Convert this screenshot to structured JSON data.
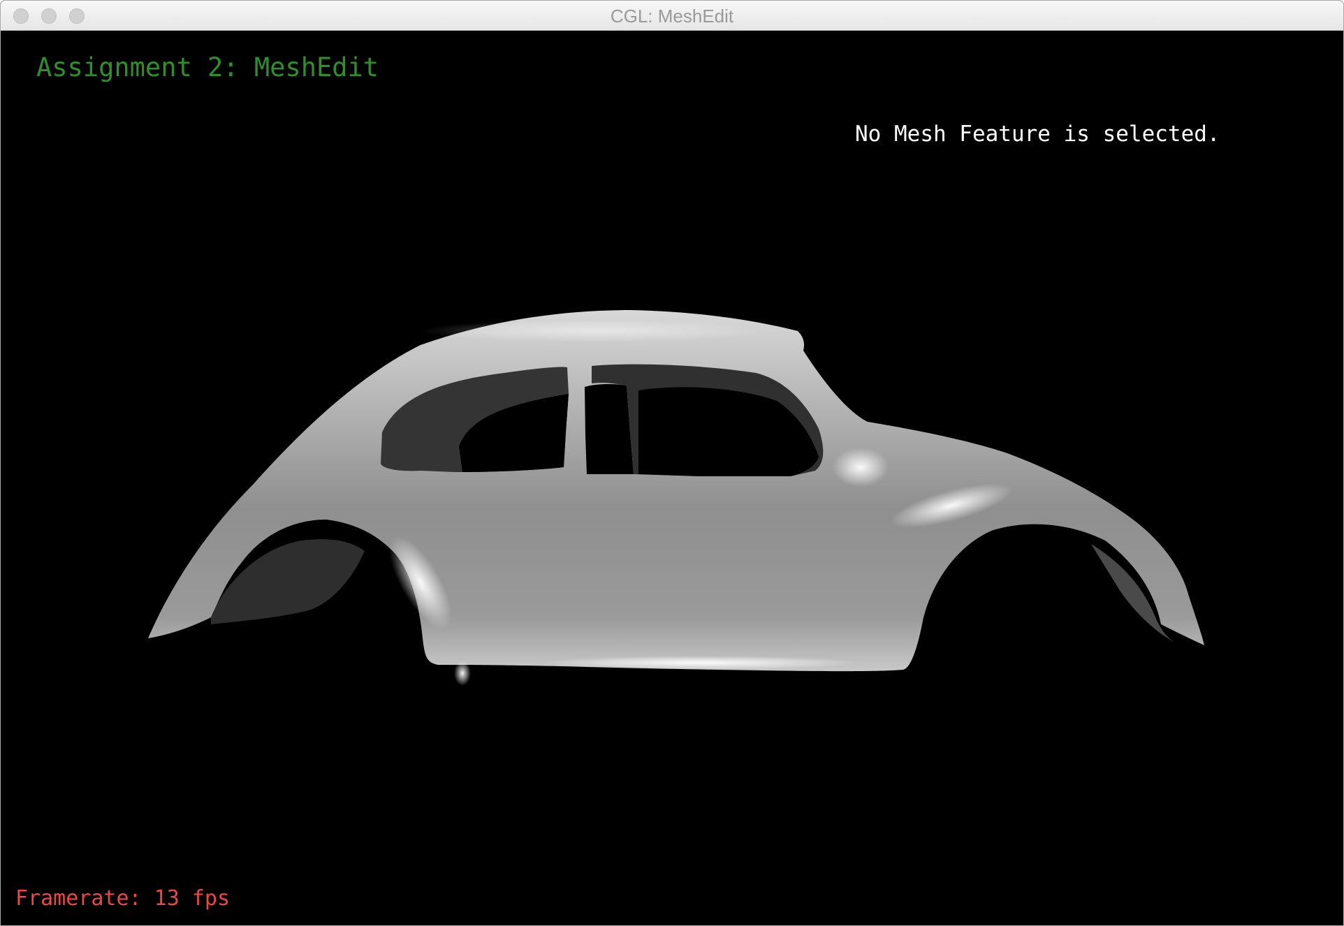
{
  "window": {
    "title": "CGL: MeshEdit",
    "controls": [
      "close",
      "minimize",
      "zoom"
    ]
  },
  "viewport": {
    "background": "#000000",
    "assignment_title": "Assignment 2: MeshEdit",
    "selection_status": "No Mesh Feature is selected.",
    "framerate_label": "Framerate: 13 fps",
    "mesh_description_colors": {
      "body": "#9c9c9c",
      "highlight": "#f2f2f2",
      "shadow": "#3a3a3a"
    }
  },
  "colors": {
    "title_green": "#2f8f2b",
    "status_white": "#ffffff",
    "framerate_red": "#ec4646"
  }
}
